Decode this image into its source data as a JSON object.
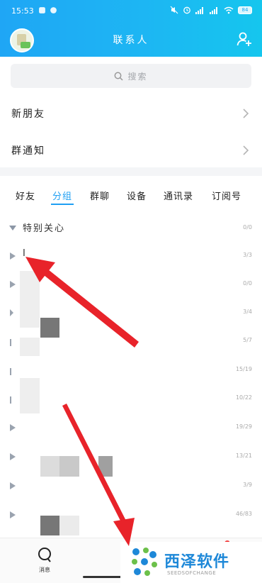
{
  "status_bar": {
    "time": "15:53",
    "battery": "84"
  },
  "header": {
    "title": "联系人"
  },
  "search": {
    "placeholder": "搜索"
  },
  "rows": [
    {
      "label": "新朋友"
    },
    {
      "label": "群通知"
    }
  ],
  "tabs": [
    {
      "label": "好友",
      "active": false
    },
    {
      "label": "分组",
      "active": true
    },
    {
      "label": "群聊",
      "active": false
    },
    {
      "label": "设备",
      "active": false
    },
    {
      "label": "通讯录",
      "active": false
    },
    {
      "label": "订阅号",
      "active": false
    }
  ],
  "groups": [
    {
      "name": "特别关心",
      "count": "0/0",
      "expanded": true
    },
    {
      "name": "I",
      "count": "3/3"
    },
    {
      "name": "",
      "count": "0/0"
    },
    {
      "name": "",
      "count": "3/4"
    },
    {
      "name": "",
      "count": "5/7"
    },
    {
      "name": "",
      "count": "15/19"
    },
    {
      "name": "",
      "count": "10/22"
    },
    {
      "name": "",
      "count": "19/29"
    },
    {
      "name": "",
      "count": "13/21"
    },
    {
      "name": "",
      "count": "3/9"
    },
    {
      "name": "",
      "count": "46/83"
    }
  ],
  "bottom_nav": {
    "messages_label": "消息"
  },
  "watermark": {
    "name": "西泽软件",
    "sub": "SEEDSOFCHANGE"
  },
  "colors": {
    "accent": "#1f9ff3",
    "header_start": "#1fa6f5",
    "header_end": "#15c6ee",
    "arrow": "#e8232a"
  }
}
